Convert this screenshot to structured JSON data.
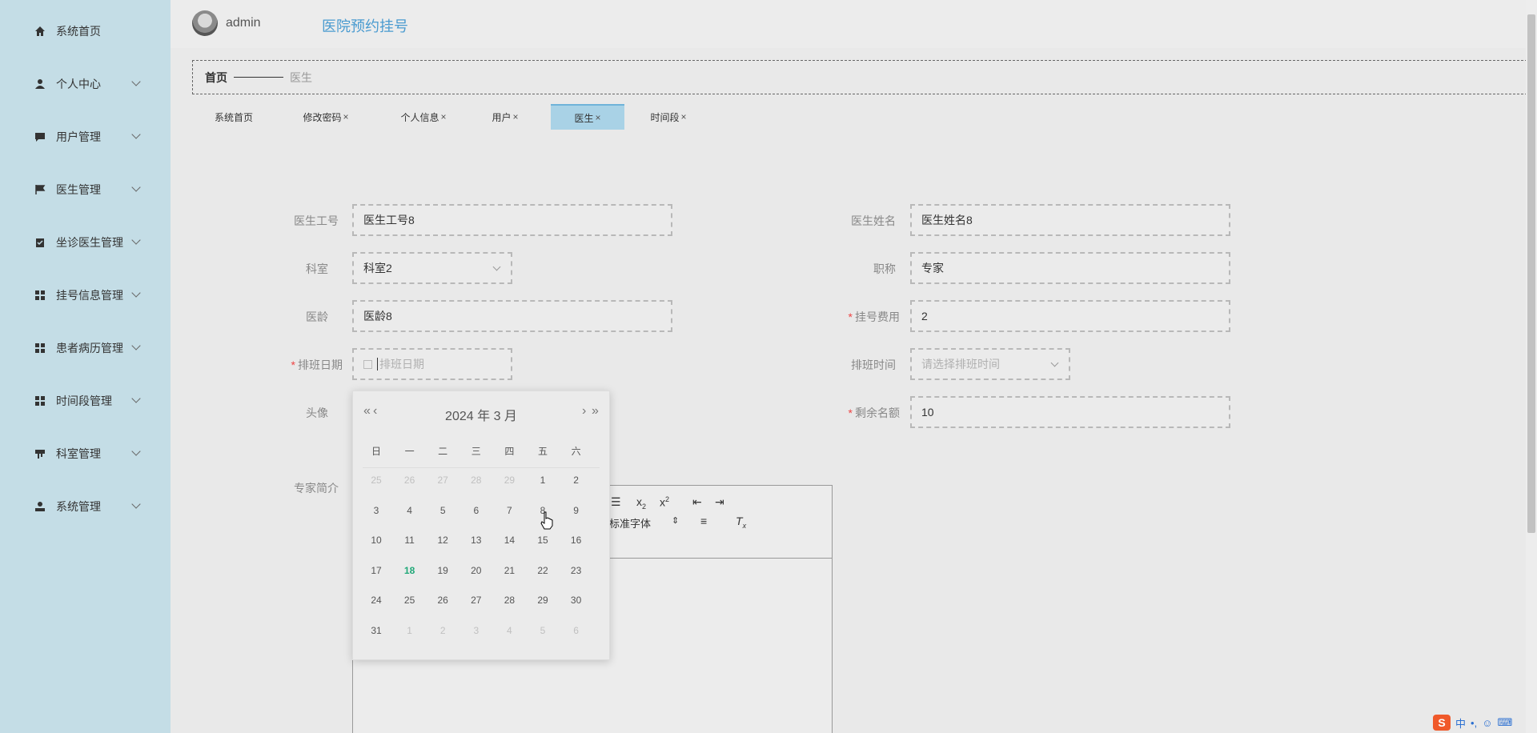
{
  "sidebar": {
    "items": [
      {
        "label": "系统首页",
        "icon": "home-icon",
        "has_submenu": false
      },
      {
        "label": "个人中心",
        "icon": "user-icon",
        "has_submenu": true
      },
      {
        "label": "用户管理",
        "icon": "chat-icon",
        "has_submenu": true
      },
      {
        "label": "医生管理",
        "icon": "flag-icon",
        "has_submenu": true
      },
      {
        "label": "坐诊医生管理",
        "icon": "clipboard-check-icon",
        "has_submenu": true
      },
      {
        "label": "挂号信息管理",
        "icon": "grid-icon",
        "has_submenu": true
      },
      {
        "label": "患者病历管理",
        "icon": "grid-icon",
        "has_submenu": true
      },
      {
        "label": "时间段管理",
        "icon": "grid-icon",
        "has_submenu": true
      },
      {
        "label": "科室管理",
        "icon": "desk-icon",
        "has_submenu": true
      },
      {
        "label": "系统管理",
        "icon": "admin-user-icon",
        "has_submenu": true
      }
    ]
  },
  "header": {
    "username": "admin",
    "title": "医院预约挂号"
  },
  "breadcrumb": {
    "home": "首页",
    "current": "医生"
  },
  "tabs": [
    {
      "label": "系统首页",
      "closable": false,
      "active": false
    },
    {
      "label": "修改密码",
      "closable": true,
      "active": false
    },
    {
      "label": "个人信息",
      "closable": true,
      "active": false
    },
    {
      "label": "用户",
      "closable": true,
      "active": false
    },
    {
      "label": "医生",
      "closable": true,
      "active": true
    },
    {
      "label": "时间段",
      "closable": true,
      "active": false
    }
  ],
  "close_glyph": "×",
  "form": {
    "doctor_id": {
      "label": "医生工号",
      "value": "医生工号8"
    },
    "doctor_name": {
      "label": "医生姓名",
      "value": "医生姓名8"
    },
    "department": {
      "label": "科室",
      "value": "科室2"
    },
    "title": {
      "label": "职称",
      "value": "专家"
    },
    "seniority": {
      "label": "医龄",
      "value": "医龄8"
    },
    "fee": {
      "label": "挂号费用",
      "value": "2",
      "required": true
    },
    "schedule_date": {
      "label": "排班日期",
      "placeholder": "排班日期",
      "required": true
    },
    "schedule_time": {
      "label": "排班时间",
      "placeholder": "请选择排班时间"
    },
    "avatar": {
      "label": "头像"
    },
    "remaining": {
      "label": "剩余名额",
      "value": "10",
      "required": true
    },
    "intro": {
      "label": "专家简介"
    },
    "required_mark": "*"
  },
  "editor": {
    "font_select": "标准字体"
  },
  "datepicker": {
    "year": "2024",
    "year_suffix": "年",
    "month": "3",
    "month_suffix": "月",
    "prev_year": "«",
    "prev_month": "‹",
    "next_month": "›",
    "next_year": "»",
    "weekdays": [
      "日",
      "一",
      "二",
      "三",
      "四",
      "五",
      "六"
    ],
    "weeks": [
      [
        "25",
        "26",
        "27",
        "28",
        "29",
        "1",
        "2"
      ],
      [
        "3",
        "4",
        "5",
        "6",
        "7",
        "8",
        "9"
      ],
      [
        "10",
        "11",
        "12",
        "13",
        "14",
        "15",
        "16"
      ],
      [
        "17",
        "18",
        "19",
        "20",
        "21",
        "22",
        "23"
      ],
      [
        "24",
        "25",
        "26",
        "27",
        "28",
        "29",
        "30"
      ],
      [
        "31",
        "1",
        "2",
        "3",
        "4",
        "5",
        "6"
      ]
    ],
    "today": "18"
  },
  "ime": {
    "logo": "S",
    "mode": "中"
  }
}
